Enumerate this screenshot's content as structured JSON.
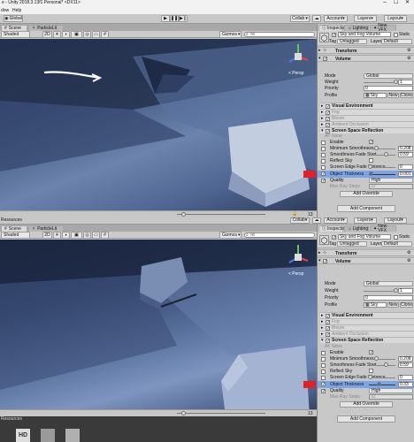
{
  "app": {
    "title": "e - Unity 2018.3.13f1 Personal* <DX11>",
    "menu_window": "dow",
    "menu_help": "Help",
    "pivot_label": "Global",
    "collab_label": "Collab",
    "account_label": "Account",
    "layers_label": "Layers",
    "layout_label": "Layout"
  },
  "top": {
    "scene_tabs": [
      "Scene",
      "ParticleLit"
    ],
    "shaded": "Shaded",
    "mode_2d": "2D",
    "gizmos": "Gizmos",
    "search": "All",
    "persp": "< Persp",
    "footer_count": "13",
    "inspector": {
      "tabs": [
        "Inspector",
        "Lighting",
        "New VFX"
      ],
      "object_name": "Sky and Fog Volume",
      "static": "Static",
      "tag_label": "Tag",
      "tag_value": "Untagged",
      "layer_label": "Layer",
      "layer_value": "Default",
      "transform": "Transform",
      "volume": "Volume",
      "mode_label": "Mode",
      "mode_value": "Global",
      "weight_label": "Weight",
      "weight_value": "1",
      "weight_fraction": 1.0,
      "priority_label": "Priority",
      "priority_value": "0",
      "profile_label": "Profile",
      "profile_value": "Sky",
      "new_label": "New",
      "clone_label": "Clone",
      "visual_env": "Visual Environment",
      "fog": "Fog",
      "bloom": "Bloom",
      "ao": "Ambient Occlusion",
      "ssr": "Screen Space Reflection",
      "all": "All",
      "none": "None",
      "enable": "Enable",
      "min_smooth_label": "Minimum Smoothness",
      "min_smooth_value": "0.208",
      "min_smooth_fraction": 0.208,
      "smooth_fade_label": "Smoothness Fade Start",
      "smooth_fade_value": "0.59",
      "smooth_fade_fraction": 0.59,
      "reflect_sky": "Reflect Sky",
      "edge_fade_label": "Screen Edge Fade Distance",
      "edge_fade_value": "0",
      "edge_fade_fraction": 0.0,
      "thickness_label": "Object Thickness",
      "thickness_value": "0.001",
      "thickness_fraction": 0.001,
      "quality_label": "Quality",
      "quality_value": "High",
      "max_ray_label": "Max Ray Steps",
      "max_ray_value": "32",
      "add_override": "Add Override",
      "add_component": "Add Component"
    }
  },
  "bottom": {
    "resources_label": "Resources",
    "scene_tabs": [
      "Scene",
      "ParticleLit"
    ],
    "shaded": "Shaded",
    "mode_2d": "2D",
    "gizmos": "Gizmos",
    "search": "All",
    "persp": "< Persp",
    "footer_count": "13",
    "collab_label": "Collab",
    "account_label": "Account",
    "layers_label": "Layers",
    "layout_label": "Layout",
    "project_label": "Resources",
    "inspector": {
      "tabs": [
        "Inspector",
        "Lighting",
        "New VFX"
      ],
      "object_name": "Sky and Fog Volume",
      "static": "Static",
      "tag_label": "Tag",
      "tag_value": "Untagged",
      "layer_label": "Layer",
      "layer_value": "Default",
      "transform": "Transform",
      "volume": "Volume",
      "mode_label": "Mode",
      "mode_value": "Global",
      "weight_label": "Weight",
      "weight_value": "1",
      "weight_fraction": 1.0,
      "priority_label": "Priority",
      "priority_value": "0",
      "profile_label": "Profile",
      "profile_value": "Sky",
      "new_label": "New",
      "clone_label": "Clone",
      "visual_env": "Visual Environment",
      "fog": "Fog",
      "bloom": "Bloom",
      "ao": "Ambient Occlusion",
      "ssr": "Screen Space Reflection",
      "all": "All",
      "none": "None",
      "enable": "Enable",
      "min_smooth_label": "Minimum Smoothness",
      "min_smooth_value": "0.208",
      "min_smooth_fraction": 0.208,
      "smooth_fade_label": "Smoothness Fade Start",
      "smooth_fade_value": "0.59",
      "smooth_fade_fraction": 0.59,
      "reflect_sky": "Reflect Sky",
      "edge_fade_label": "Screen Edge Fade Distance",
      "edge_fade_value": "0",
      "edge_fade_fraction": 0.0,
      "thickness_label": "Object Thickness",
      "thickness_value": "0.33",
      "thickness_fraction": 0.33,
      "quality_label": "Quality",
      "quality_value": "High",
      "max_ray_label": "Max Ray Steps",
      "max_ray_value": "32",
      "add_override": "Add Override",
      "add_component": "Add Component"
    }
  },
  "colors": {
    "highlight_red": "#e0202a",
    "scene_dark": "#1e2a44",
    "scene_light": "#6f86b0",
    "selection_blue": "#3d6fd6"
  }
}
